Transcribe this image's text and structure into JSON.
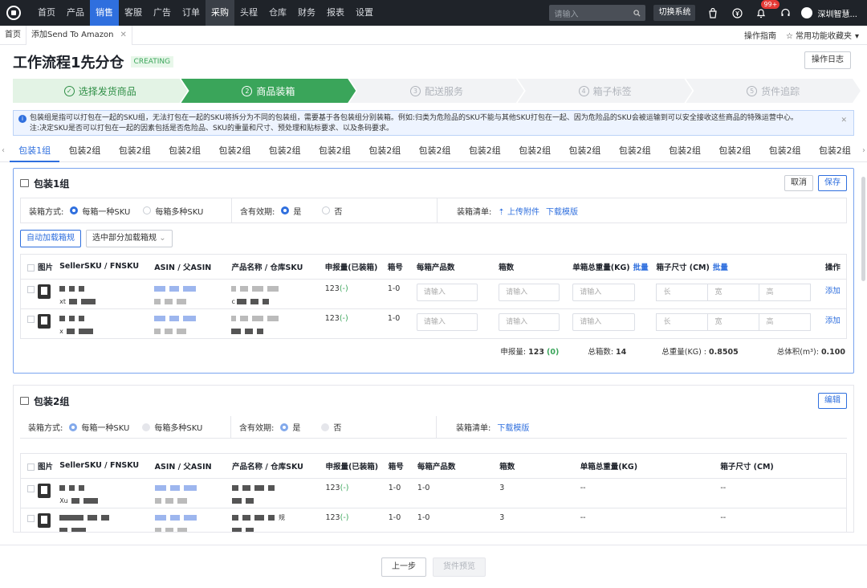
{
  "nav": {
    "items": [
      "首页",
      "产品",
      "销售",
      "客服",
      "广告",
      "订单",
      "采购",
      "头程",
      "仓库",
      "财务",
      "报表",
      "设置"
    ],
    "active_index": 6,
    "selected_index": 2,
    "search_placeholder": "请输入",
    "switch_label": "切换系统",
    "badge": "99+",
    "company": "深圳智慧..."
  },
  "tabs": {
    "home": "首页",
    "current": "添加Send To Amazon",
    "guide": "操作指南",
    "favorites": "常用功能收藏夹"
  },
  "page": {
    "title": "工作流程1先分仓",
    "status": "CREATING",
    "log_button": "操作日志"
  },
  "steps": [
    {
      "num": "1",
      "label": "选择发货商品",
      "state": "done"
    },
    {
      "num": "2",
      "label": "商品装箱",
      "state": "current"
    },
    {
      "num": "3",
      "label": "配送服务",
      "state": "todo"
    },
    {
      "num": "4",
      "label": "箱子标签",
      "state": "todo"
    },
    {
      "num": "5",
      "label": "货件追踪",
      "state": "todo"
    }
  ],
  "alert": {
    "line1": "包装组是指可以打包在一起的SKU组，无法打包在一起的SKU将拆分为不同的包装组，需要基于各包装组分别装箱。例如:归类为危险品的SKU不能与其他SKU打包在一起、因为危险品的SKU会被运输到可以安全接收这些商品的特殊运营中心。",
    "line2": "注:决定SKU是否可以打包在一起的因素包括是否危险品、SKU的重量和尺寸、预处理和贴标要求、以及条码要求。"
  },
  "group_tabs": [
    "包装1组",
    "包装2组",
    "包装2组",
    "包装2组",
    "包装2组",
    "包装2组",
    "包装2组",
    "包装2组",
    "包装2组",
    "包装2组",
    "包装2组",
    "包装2组",
    "包装2组",
    "包装2组",
    "包装2组",
    "包装2组",
    "包装2组"
  ],
  "group1": {
    "title": "包装1组",
    "cancel": "取消",
    "save": "保存",
    "pack_mode_label": "装箱方式:",
    "pack_one": "每箱一种SKU",
    "pack_multi": "每箱多种SKU",
    "expiry_label": "含有效期:",
    "yes": "是",
    "no": "否",
    "list_label": "装箱清单:",
    "upload": "上传附件",
    "download": "下载模版",
    "auto_btn": "自动加载箱规",
    "partial_btn": "选中部分加载箱规",
    "headers": [
      "图片",
      "SellerSKU / FNSKU",
      "ASIN / 父ASIN",
      "产品名称 / 仓库SKU",
      "申报量(已装箱)",
      "箱号",
      "每箱产品数",
      "箱数",
      "单箱总重量(KG)",
      "箱子尺寸 (CM)",
      "操作"
    ],
    "batch": "批量",
    "placeholder": "请输入",
    "dim_long": "长",
    "dim_wide": "宽",
    "dim_high": "高",
    "add": "添加",
    "rows": [
      {
        "declared": "123",
        "packed": "(-)",
        "box_no": "1-0",
        "sku_tail": "xt",
        "name_tail": "c"
      },
      {
        "declared": "123",
        "packed": "(-)",
        "box_no": "1-0",
        "sku_tail": "x",
        "name_tail": ""
      }
    ],
    "summary": {
      "declared_label": "申报量:",
      "declared": "123",
      "declared_packed": "(0)",
      "boxes_label": "总箱数:",
      "boxes": "14",
      "weight_label": "总重量(KG) :",
      "weight": "0.8505",
      "volume_label": "总体积(m³):",
      "volume": "0.100"
    }
  },
  "group2": {
    "title": "包装2组",
    "edit": "编辑",
    "pack_mode_label": "装箱方式:",
    "pack_one": "每箱一种SKU",
    "pack_multi": "每箱多种SKU",
    "expiry_label": "含有效期:",
    "yes": "是",
    "no": "否",
    "list_label": "装箱清单:",
    "download": "下载模版",
    "headers": [
      "图片",
      "SellerSKU / FNSKU",
      "ASIN / 父ASIN",
      "产品名称 / 仓库SKU",
      "申报量(已装箱)",
      "箱号",
      "每箱产品数",
      "箱数",
      "单箱总重量(KG)",
      "箱子尺寸 (CM)"
    ],
    "rows": [
      {
        "declared": "123",
        "packed": "(-)",
        "box_no": "1-0",
        "per_box": "1-0",
        "boxes": "3",
        "weight": "--",
        "size": "--",
        "sku_tail": "Xu",
        "name_tail": ""
      },
      {
        "declared": "123",
        "packed": "(-)",
        "box_no": "1-0",
        "per_box": "1-0",
        "boxes": "3",
        "weight": "--",
        "size": "--",
        "sku_tail": "",
        "name_tail": "规"
      }
    ]
  },
  "footer": {
    "prev": "上一步",
    "preview": "货件预览"
  }
}
